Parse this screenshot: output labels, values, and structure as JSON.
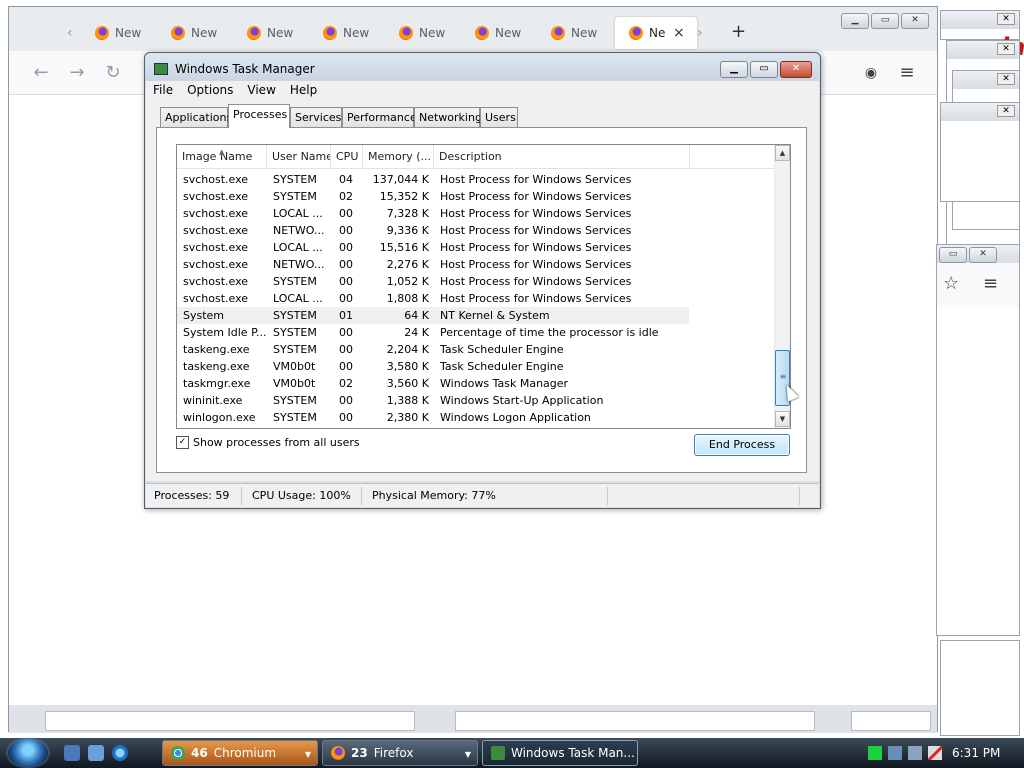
{
  "firefox": {
    "tabs": [
      {
        "label": "New T"
      },
      {
        "label": "New T"
      },
      {
        "label": "New T"
      },
      {
        "label": "New T"
      },
      {
        "label": "New T"
      },
      {
        "label": "New T"
      },
      {
        "label": "New T"
      },
      {
        "label": "Ne"
      }
    ],
    "new_tab_glyph": "+",
    "back_glyph": "←",
    "forward_glyph": "→",
    "reload_glyph": "↻",
    "pocket_glyph": "◉",
    "menu_glyph": "≡",
    "star_glyph": "☆"
  },
  "task_manager": {
    "title": "Windows Task Manager",
    "menu": [
      "File",
      "Options",
      "View",
      "Help"
    ],
    "tabs": [
      "Applications",
      "Processes",
      "Services",
      "Performance",
      "Networking",
      "Users"
    ],
    "active_tab": "Processes",
    "columns": [
      "Image Name",
      "User Name",
      "CPU",
      "Memory (...",
      "Description"
    ],
    "rows": [
      {
        "image": "svchost.exe",
        "user": "SYSTEM",
        "cpu": "04",
        "mem": "137,044 K",
        "desc": "Host Process for Windows Services"
      },
      {
        "image": "svchost.exe",
        "user": "SYSTEM",
        "cpu": "02",
        "mem": "15,352 K",
        "desc": "Host Process for Windows Services"
      },
      {
        "image": "svchost.exe",
        "user": "LOCAL ...",
        "cpu": "00",
        "mem": "7,328 K",
        "desc": "Host Process for Windows Services"
      },
      {
        "image": "svchost.exe",
        "user": "NETWO...",
        "cpu": "00",
        "mem": "9,336 K",
        "desc": "Host Process for Windows Services"
      },
      {
        "image": "svchost.exe",
        "user": "LOCAL ...",
        "cpu": "00",
        "mem": "15,516 K",
        "desc": "Host Process for Windows Services"
      },
      {
        "image": "svchost.exe",
        "user": "NETWO...",
        "cpu": "00",
        "mem": "2,276 K",
        "desc": "Host Process for Windows Services"
      },
      {
        "image": "svchost.exe",
        "user": "SYSTEM",
        "cpu": "00",
        "mem": "1,052 K",
        "desc": "Host Process for Windows Services"
      },
      {
        "image": "svchost.exe",
        "user": "LOCAL ...",
        "cpu": "00",
        "mem": "1,808 K",
        "desc": "Host Process for Windows Services"
      },
      {
        "image": "System",
        "user": "SYSTEM",
        "cpu": "01",
        "mem": "64 K",
        "desc": "NT Kernel & System"
      },
      {
        "image": "System Idle P...",
        "user": "SYSTEM",
        "cpu": "00",
        "mem": "24 K",
        "desc": "Percentage of time the processor is idle"
      },
      {
        "image": "taskeng.exe",
        "user": "SYSTEM",
        "cpu": "00",
        "mem": "2,204 K",
        "desc": "Task Scheduler Engine"
      },
      {
        "image": "taskeng.exe",
        "user": "VM0b0t",
        "cpu": "00",
        "mem": "3,580 K",
        "desc": "Task Scheduler Engine"
      },
      {
        "image": "taskmgr.exe",
        "user": "VM0b0t",
        "cpu": "02",
        "mem": "3,560 K",
        "desc": "Windows Task Manager"
      },
      {
        "image": "wininit.exe",
        "user": "SYSTEM",
        "cpu": "00",
        "mem": "1,388 K",
        "desc": "Windows Start-Up Application"
      },
      {
        "image": "winlogon.exe",
        "user": "SYSTEM",
        "cpu": "00",
        "mem": "2,380 K",
        "desc": "Windows Logon Application"
      }
    ],
    "selected_row": "System",
    "show_all_label": "Show processes from all users",
    "show_all_checked": "✓",
    "end_process_label": "End Process",
    "status": {
      "processes": "Processes: 59",
      "cpu": "CPU Usage: 100%",
      "memory": "Physical Memory: 77%"
    }
  },
  "taskbar": {
    "buttons": [
      {
        "count": "46",
        "label": "Chromium"
      },
      {
        "count": "23",
        "label": "Firefox"
      },
      {
        "count": "",
        "label": "Windows Task Man..."
      }
    ],
    "clock": "6:31 PM"
  },
  "colors": {
    "firefox_chrome": "#e9ecef",
    "task_manager_frame": "#d7dfe9",
    "end_process_button": "#bee6fd",
    "taskbar": "#1b2632",
    "chromium_button": "#e59a47"
  }
}
